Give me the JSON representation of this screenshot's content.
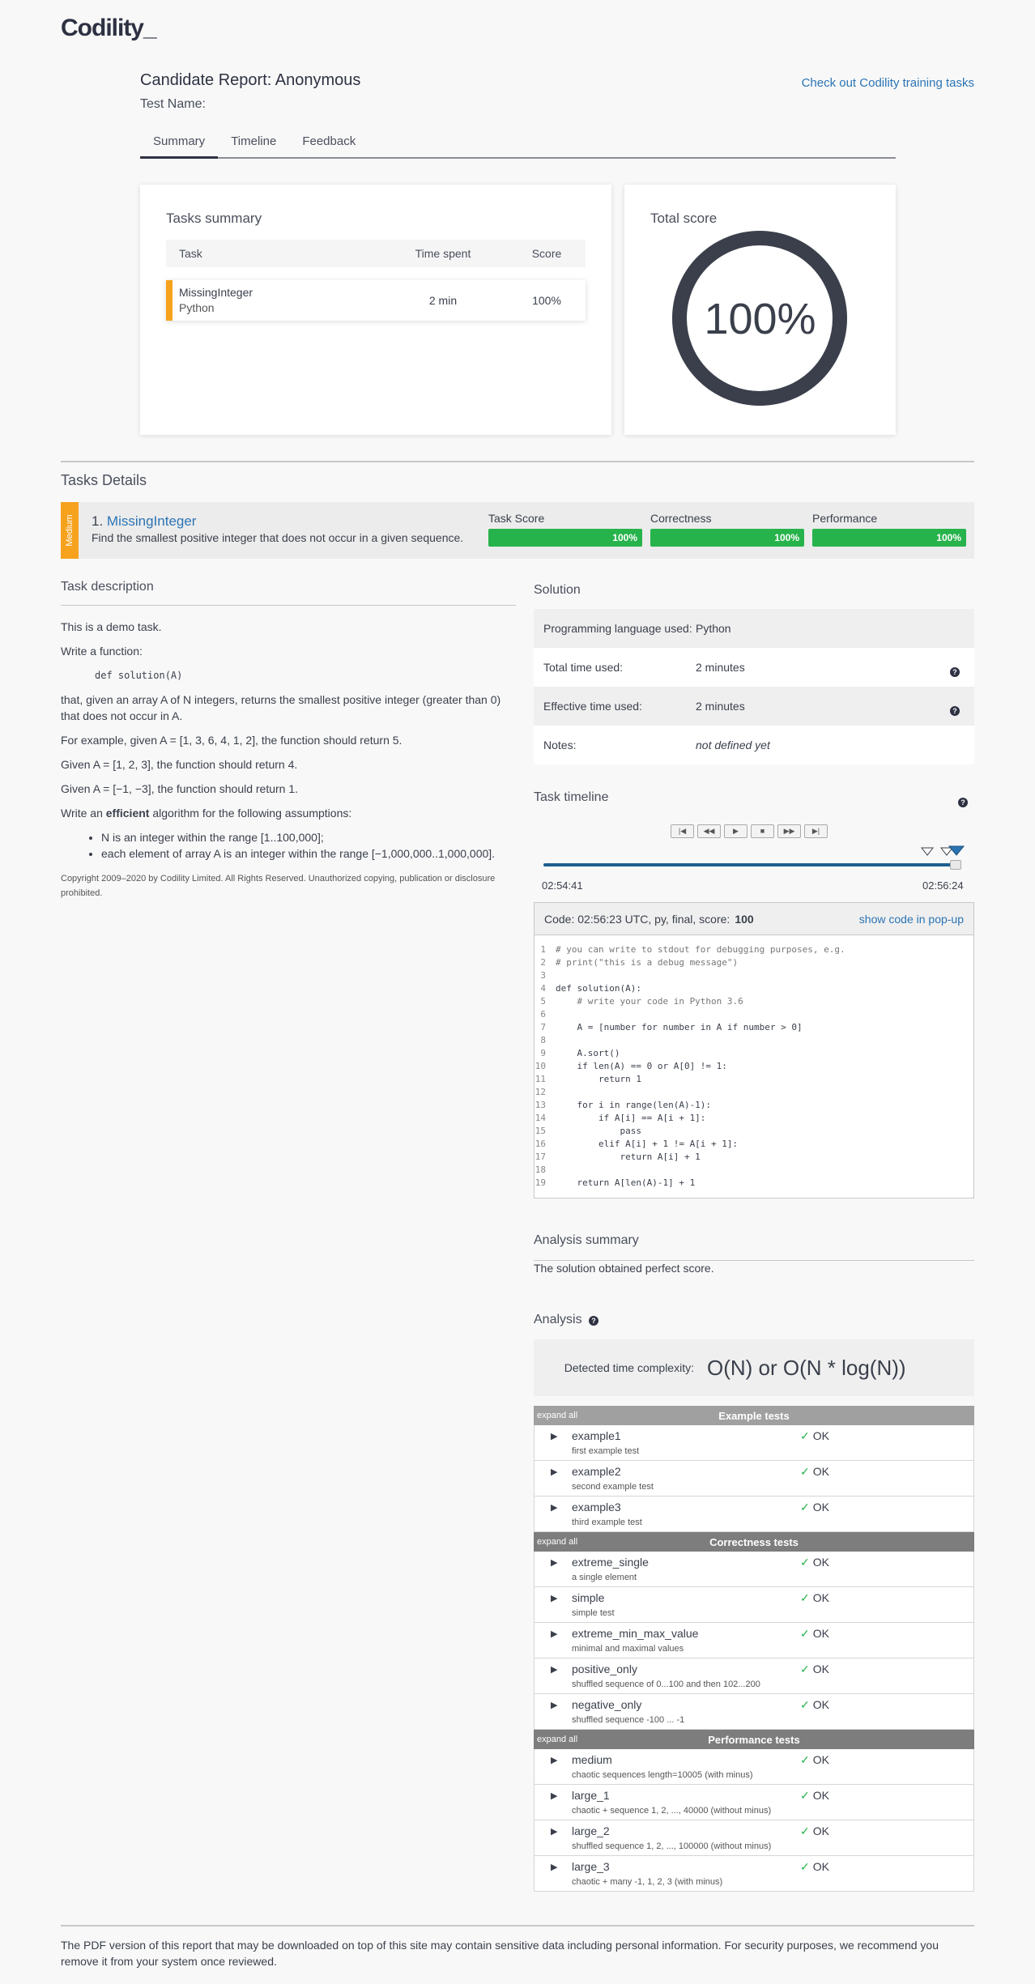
{
  "logo": "Codility_",
  "header": {
    "report_label": "Candidate Report:",
    "candidate": "Anonymous",
    "test_name_label": "Test Name:",
    "training_link": "Check out Codility training tasks"
  },
  "tabs": [
    "Summary",
    "Timeline",
    "Feedback"
  ],
  "tasks_summary": {
    "title": "Tasks summary",
    "columns": [
      "Task",
      "Time spent",
      "Score"
    ],
    "rows": [
      {
        "task": "MissingInteger",
        "language": "Python",
        "time": "2 min",
        "score": "100%"
      }
    ]
  },
  "total_score": {
    "title": "Total score",
    "value": "100%",
    "fraction": 1.0
  },
  "tasks_details": {
    "title": "Tasks Details",
    "difficulty": "Medium",
    "number": "1.",
    "name": "MissingInteger",
    "summary": "Find the smallest positive integer that does not occur in a given sequence.",
    "metrics": [
      {
        "label": "Task Score",
        "value": "100%"
      },
      {
        "label": "Correctness",
        "value": "100%"
      },
      {
        "label": "Performance",
        "value": "100%"
      }
    ]
  },
  "task_description": {
    "title": "Task description",
    "intro": "This is a demo task.",
    "write_function": "Write a function:",
    "signature": "def solution(A)",
    "body": "that, given an array A of N integers, returns the smallest positive integer (greater than 0) that does not occur in A.",
    "example1": "For example, given A = [1, 3, 6, 4, 1, 2], the function should return 5.",
    "example2": "Given A = [1, 2, 3], the function should return 4.",
    "example3": "Given A = [−1, −3], the function should return 1.",
    "algo_pre": "Write an",
    "algo_bold": "efficient",
    "algo_post": "algorithm for the following assumptions:",
    "assumptions": [
      "N is an integer within the range [1..100,000];",
      "each element of array A is an integer within the range [−1,000,000..1,000,000]."
    ],
    "copyright": "Copyright 2009–2020 by Codility Limited. All Rights Reserved. Unauthorized copying, publication or disclosure prohibited."
  },
  "solution": {
    "title": "Solution",
    "rows": [
      {
        "label": "Programming language used:",
        "value": "Python"
      },
      {
        "label": "Total time used:",
        "value": "2 minutes"
      },
      {
        "label": "Effective time used:",
        "value": "2 minutes"
      },
      {
        "label": "Notes:",
        "value": "not defined yet"
      }
    ]
  },
  "timeline": {
    "title": "Task timeline",
    "start": "02:54:41",
    "end": "02:56:24",
    "controls": [
      "|◀",
      "◀◀",
      "▶",
      "■",
      "▶▶",
      "▶|"
    ]
  },
  "code": {
    "header_pre": "Code: 02:56:23 UTC, py, final, score:",
    "score": "100",
    "popup_link": "show code in pop-up",
    "lines": [
      "# you can write to stdout for debugging purposes, e.g.",
      "# print(\"this is a debug message\")",
      "",
      "def solution(A):",
      "    # write your code in Python 3.6",
      "",
      "    A = [number for number in A if number > 0]",
      "",
      "    A.sort()",
      "    if len(A) == 0 or A[0] != 1:",
      "        return 1",
      "",
      "    for i in range(len(A)-1):",
      "        if A[i] == A[i + 1]:",
      "            pass",
      "        elif A[i] + 1 != A[i + 1]:",
      "            return A[i] + 1",
      "",
      "    return A[len(A)-1] + 1"
    ]
  },
  "analysis_summary": {
    "title": "Analysis summary",
    "text": "The solution obtained perfect score."
  },
  "analysis": {
    "title": "Analysis",
    "complexity_label": "Detected time complexity:",
    "complexity": "O(N) or O(N * log(N))"
  },
  "test_groups": [
    {
      "expand": "expand all",
      "title": "Example tests",
      "tests": [
        {
          "name": "example1",
          "desc": "first example test",
          "result": "OK"
        },
        {
          "name": "example2",
          "desc": "second example test",
          "result": "OK"
        },
        {
          "name": "example3",
          "desc": "third example test",
          "result": "OK"
        }
      ]
    },
    {
      "expand": "expand all",
      "title": "Correctness tests",
      "tests": [
        {
          "name": "extreme_single",
          "desc": "a single element",
          "result": "OK"
        },
        {
          "name": "simple",
          "desc": "simple test",
          "result": "OK"
        },
        {
          "name": "extreme_min_max_value",
          "desc": "minimal and maximal values",
          "result": "OK"
        },
        {
          "name": "positive_only",
          "desc": "shuffled sequence of 0...100 and then 102...200",
          "result": "OK"
        },
        {
          "name": "negative_only",
          "desc": "shuffled sequence -100 ... -1",
          "result": "OK"
        }
      ]
    },
    {
      "expand": "expand all",
      "title": "Performance tests",
      "tests": [
        {
          "name": "medium",
          "desc": "chaotic sequences length=10005 (with minus)",
          "result": "OK"
        },
        {
          "name": "large_1",
          "desc": "chaotic + sequence 1, 2, ..., 40000 (without minus)",
          "result": "OK"
        },
        {
          "name": "large_2",
          "desc": "shuffled sequence 1, 2, ..., 100000 (without minus)",
          "result": "OK"
        },
        {
          "name": "large_3",
          "desc": "chaotic + many -1, 1, 2, 3 (with minus)",
          "result": "OK"
        }
      ]
    }
  ],
  "footer": "The PDF version of this report that may be downloaded on top of this site may contain sensitive data including personal information. For security purposes, we recommend you remove it from your system once reviewed.",
  "colors": {
    "accent": "#2b74b4",
    "ok": "#27b34b",
    "medium": "#f6a21d",
    "dark": "#2d3142"
  }
}
